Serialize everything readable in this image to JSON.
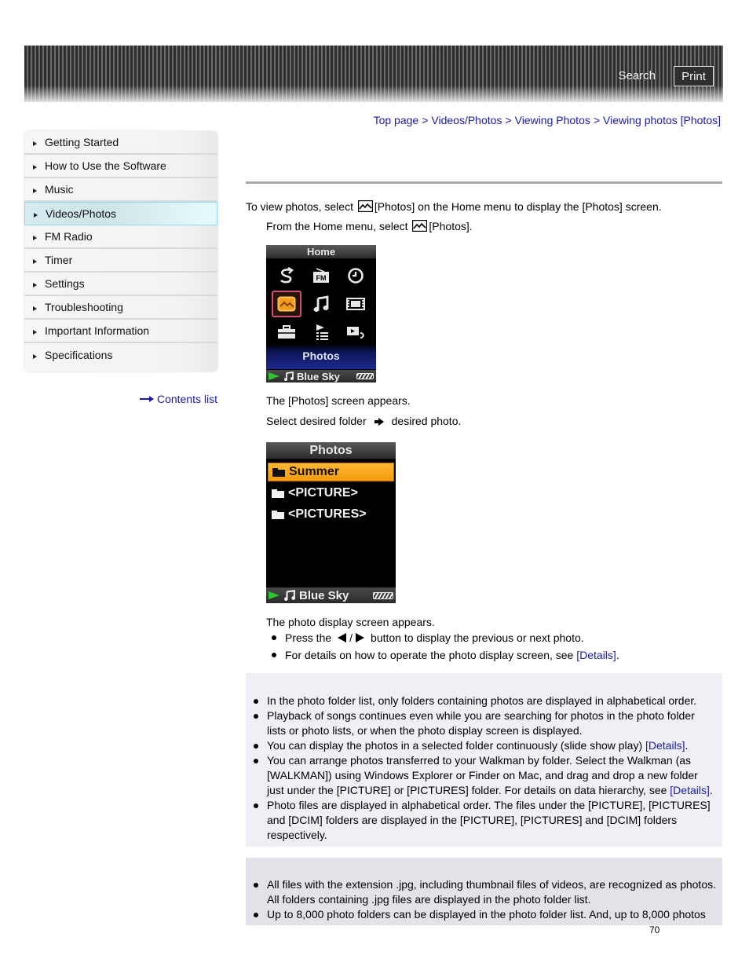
{
  "header": {
    "search_label": "Search",
    "print_label": "Print"
  },
  "breadcrumb": [
    {
      "label": "Top page"
    },
    {
      "label": "Videos/Photos"
    },
    {
      "label": "Viewing Photos"
    },
    {
      "label": "Viewing photos [Photos]"
    }
  ],
  "breadcrumb_separator": ">",
  "sidebar": {
    "items": [
      {
        "label": "Getting Started",
        "active": false
      },
      {
        "label": "How to Use the Software",
        "active": false
      },
      {
        "label": "Music",
        "active": false
      },
      {
        "label": "Videos/Photos",
        "active": true
      },
      {
        "label": "FM Radio",
        "active": false
      },
      {
        "label": "Timer",
        "active": false
      },
      {
        "label": "Settings",
        "active": false
      },
      {
        "label": "Troubleshooting",
        "active": false
      },
      {
        "label": "Important Information",
        "active": false
      },
      {
        "label": "Specifications",
        "active": false
      }
    ],
    "contents_list_label": "Contents list"
  },
  "main": {
    "intro_before": "To view photos, select",
    "intro_after": "[Photos] on the Home menu to display the [Photos] screen.",
    "step1_before": "From the Home menu, select",
    "step1_after": "[Photos].",
    "home_screen": {
      "title": "Home",
      "selected_label": "Photos",
      "icons": [
        "repeat-icon",
        "fm-radio-icon",
        "clock-icon",
        "photos-icon",
        "music-note-icon",
        "film-icon",
        "toolbox-icon",
        "playlist-icon",
        "video-return-icon"
      ],
      "now_playing": "Blue Sky"
    },
    "step1_result": "The [Photos] screen appears.",
    "step2_before": "Select desired folder",
    "step2_after": "desired photo.",
    "photos_screen": {
      "title": "Photos",
      "folders": [
        {
          "name": "Summer",
          "selected": true
        },
        {
          "name": "<PICTURE>",
          "selected": false
        },
        {
          "name": "<PICTURES>",
          "selected": false
        }
      ],
      "now_playing": "Blue Sky"
    },
    "step2_result": "The photo display screen appears.",
    "step2_bullets": {
      "b1_before": "Press the",
      "b1_slash": "/",
      "b1_after": "button to display the previous or next photo.",
      "b2_before": "For details on how to operate the photo display screen, see",
      "b2_link": "[Details]",
      "b2_after": "."
    }
  },
  "hint": {
    "items": [
      {
        "text": "In the photo folder list, only folders containing photos are displayed in alphabetical order.",
        "link": "",
        "after": ""
      },
      {
        "text": "Playback of songs continues even while you are searching for photos in the photo folder lists or photo lists, or when the photo display screen is displayed.",
        "link": "",
        "after": ""
      },
      {
        "text": "You can display the photos in a selected folder continuously (slide show play) ",
        "link": "[Details]",
        "after": "."
      },
      {
        "text": "You can arrange photos transferred to your Walkman by folder. Select the Walkman (as [WALKMAN]) using Windows Explorer or Finder on Mac, and drag and drop a new folder just under the [PICTURE] or [PICTURES] folder. For details on data hierarchy, see ",
        "link": "[Details]",
        "after": "."
      },
      {
        "text": "Photo files are displayed in alphabetical order. The files under the [PICTURE], [PICTURES] and [DCIM] folders are displayed in the [PICTURE], [PICTURES] and [DCIM] folders respectively.",
        "link": "",
        "after": ""
      }
    ]
  },
  "note": {
    "items": [
      {
        "text": "All files with the extension .jpg, including thumbnail files of videos, are recognized as photos. All folders containing .jpg files are displayed in the photo folder list."
      },
      {
        "text": "Up to 8,000 photo folders can be displayed in the photo folder list. And, up to 8,000 photos"
      }
    ]
  },
  "page_number": "70",
  "colors": {
    "link": "#1a1aa6",
    "active_nav_bg": "#d4ecef",
    "active_nav_border": "#8fd8ee",
    "hint_bg": "#eef0f5",
    "note_bg": "#e1e3e8",
    "selected_folder": "#f7a21a",
    "play_indicator": "#2fc42f"
  }
}
